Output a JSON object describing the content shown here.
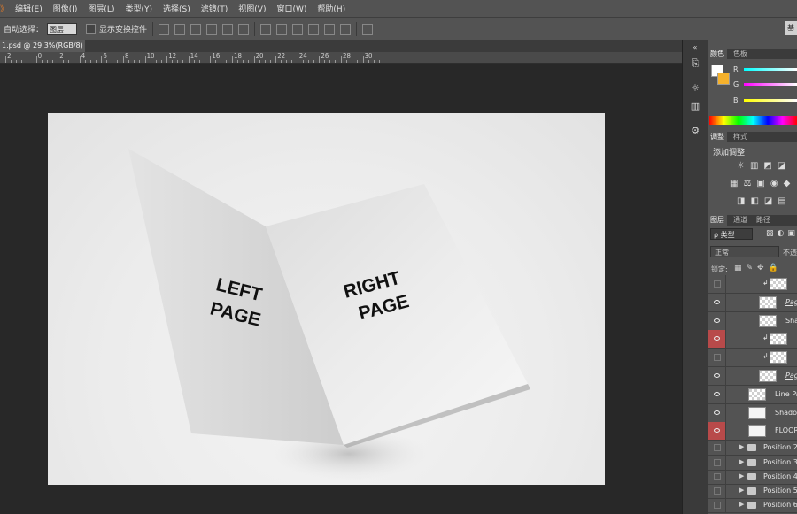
{
  "menubar": {
    "lead": "》",
    "items": [
      "编辑(E)",
      "图像(I)",
      "图层(L)",
      "类型(Y)",
      "选择(S)",
      "滤镜(T)",
      "视图(V)",
      "窗口(W)",
      "帮助(H)"
    ]
  },
  "options": {
    "auto_select_label": "自动选择：",
    "auto_select_value": "图层",
    "show_transform_label": "显示变换控件",
    "right_btn": "基"
  },
  "document": {
    "tab_title": "1.psd @ 29.3%(RGB/8) *",
    "ruler_ticks": [
      "2",
      "0",
      "2",
      "4",
      "6",
      "8",
      "10",
      "12",
      "14",
      "16",
      "18",
      "20",
      "22",
      "24",
      "26",
      "28",
      "30"
    ]
  },
  "mockup": {
    "left_page_text": [
      "LEFT",
      "PAGE"
    ],
    "right_page_text": [
      "RIGHT",
      "PAGE"
    ]
  },
  "panels": {
    "color_tabs": [
      "颜色",
      "色板"
    ],
    "rgb": [
      "R",
      "G",
      "B"
    ],
    "adjust_tabs": [
      "调整",
      "样式"
    ],
    "add_adjust": "添加调整",
    "layer_tabs": [
      "图层",
      "通道",
      "路径"
    ],
    "filter_label": "ρ 类型",
    "blend_mode": "正常",
    "opacity_label": "不透",
    "lock_label": "锁定:",
    "layers": [
      {
        "name": "",
        "visible": false,
        "red": false,
        "thumb": "pattern",
        "clip": true
      },
      {
        "name": "Pag",
        "visible": true,
        "red": false,
        "thumb": "pattern",
        "ul": true
      },
      {
        "name": "Sha",
        "visible": true,
        "red": false,
        "thumb": "pattern"
      },
      {
        "name": "",
        "visible": true,
        "red": true,
        "thumb": "pattern",
        "clip": true
      },
      {
        "name": "",
        "visible": false,
        "red": false,
        "thumb": "pattern",
        "clip": true
      },
      {
        "name": "Pag",
        "visible": true,
        "red": false,
        "thumb": "pattern",
        "ul": true
      },
      {
        "name": "Line Pa",
        "visible": true,
        "red": false,
        "thumb": "pattern"
      },
      {
        "name": "Shadov",
        "visible": true,
        "red": false,
        "thumb": "white"
      },
      {
        "name": "FLOOR",
        "visible": true,
        "red": true,
        "thumb": "white"
      }
    ],
    "folders": [
      "Position 2",
      "Position 3",
      "Position 4",
      "Position 5",
      "Position 6"
    ]
  }
}
